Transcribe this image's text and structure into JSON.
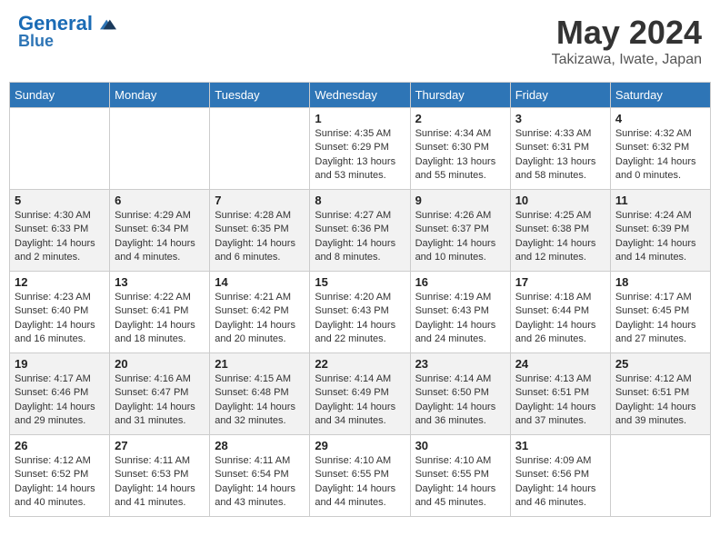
{
  "header": {
    "logo_line1": "General",
    "logo_line2": "Blue",
    "month": "May 2024",
    "location": "Takizawa, Iwate, Japan"
  },
  "weekdays": [
    "Sunday",
    "Monday",
    "Tuesday",
    "Wednesday",
    "Thursday",
    "Friday",
    "Saturday"
  ],
  "weeks": [
    [
      {
        "day": "",
        "info": ""
      },
      {
        "day": "",
        "info": ""
      },
      {
        "day": "",
        "info": ""
      },
      {
        "day": "1",
        "info": "Sunrise: 4:35 AM\nSunset: 6:29 PM\nDaylight: 13 hours\nand 53 minutes."
      },
      {
        "day": "2",
        "info": "Sunrise: 4:34 AM\nSunset: 6:30 PM\nDaylight: 13 hours\nand 55 minutes."
      },
      {
        "day": "3",
        "info": "Sunrise: 4:33 AM\nSunset: 6:31 PM\nDaylight: 13 hours\nand 58 minutes."
      },
      {
        "day": "4",
        "info": "Sunrise: 4:32 AM\nSunset: 6:32 PM\nDaylight: 14 hours\nand 0 minutes."
      }
    ],
    [
      {
        "day": "5",
        "info": "Sunrise: 4:30 AM\nSunset: 6:33 PM\nDaylight: 14 hours\nand 2 minutes."
      },
      {
        "day": "6",
        "info": "Sunrise: 4:29 AM\nSunset: 6:34 PM\nDaylight: 14 hours\nand 4 minutes."
      },
      {
        "day": "7",
        "info": "Sunrise: 4:28 AM\nSunset: 6:35 PM\nDaylight: 14 hours\nand 6 minutes."
      },
      {
        "day": "8",
        "info": "Sunrise: 4:27 AM\nSunset: 6:36 PM\nDaylight: 14 hours\nand 8 minutes."
      },
      {
        "day": "9",
        "info": "Sunrise: 4:26 AM\nSunset: 6:37 PM\nDaylight: 14 hours\nand 10 minutes."
      },
      {
        "day": "10",
        "info": "Sunrise: 4:25 AM\nSunset: 6:38 PM\nDaylight: 14 hours\nand 12 minutes."
      },
      {
        "day": "11",
        "info": "Sunrise: 4:24 AM\nSunset: 6:39 PM\nDaylight: 14 hours\nand 14 minutes."
      }
    ],
    [
      {
        "day": "12",
        "info": "Sunrise: 4:23 AM\nSunset: 6:40 PM\nDaylight: 14 hours\nand 16 minutes."
      },
      {
        "day": "13",
        "info": "Sunrise: 4:22 AM\nSunset: 6:41 PM\nDaylight: 14 hours\nand 18 minutes."
      },
      {
        "day": "14",
        "info": "Sunrise: 4:21 AM\nSunset: 6:42 PM\nDaylight: 14 hours\nand 20 minutes."
      },
      {
        "day": "15",
        "info": "Sunrise: 4:20 AM\nSunset: 6:43 PM\nDaylight: 14 hours\nand 22 minutes."
      },
      {
        "day": "16",
        "info": "Sunrise: 4:19 AM\nSunset: 6:43 PM\nDaylight: 14 hours\nand 24 minutes."
      },
      {
        "day": "17",
        "info": "Sunrise: 4:18 AM\nSunset: 6:44 PM\nDaylight: 14 hours\nand 26 minutes."
      },
      {
        "day": "18",
        "info": "Sunrise: 4:17 AM\nSunset: 6:45 PM\nDaylight: 14 hours\nand 27 minutes."
      }
    ],
    [
      {
        "day": "19",
        "info": "Sunrise: 4:17 AM\nSunset: 6:46 PM\nDaylight: 14 hours\nand 29 minutes."
      },
      {
        "day": "20",
        "info": "Sunrise: 4:16 AM\nSunset: 6:47 PM\nDaylight: 14 hours\nand 31 minutes."
      },
      {
        "day": "21",
        "info": "Sunrise: 4:15 AM\nSunset: 6:48 PM\nDaylight: 14 hours\nand 32 minutes."
      },
      {
        "day": "22",
        "info": "Sunrise: 4:14 AM\nSunset: 6:49 PM\nDaylight: 14 hours\nand 34 minutes."
      },
      {
        "day": "23",
        "info": "Sunrise: 4:14 AM\nSunset: 6:50 PM\nDaylight: 14 hours\nand 36 minutes."
      },
      {
        "day": "24",
        "info": "Sunrise: 4:13 AM\nSunset: 6:51 PM\nDaylight: 14 hours\nand 37 minutes."
      },
      {
        "day": "25",
        "info": "Sunrise: 4:12 AM\nSunset: 6:51 PM\nDaylight: 14 hours\nand 39 minutes."
      }
    ],
    [
      {
        "day": "26",
        "info": "Sunrise: 4:12 AM\nSunset: 6:52 PM\nDaylight: 14 hours\nand 40 minutes."
      },
      {
        "day": "27",
        "info": "Sunrise: 4:11 AM\nSunset: 6:53 PM\nDaylight: 14 hours\nand 41 minutes."
      },
      {
        "day": "28",
        "info": "Sunrise: 4:11 AM\nSunset: 6:54 PM\nDaylight: 14 hours\nand 43 minutes."
      },
      {
        "day": "29",
        "info": "Sunrise: 4:10 AM\nSunset: 6:55 PM\nDaylight: 14 hours\nand 44 minutes."
      },
      {
        "day": "30",
        "info": "Sunrise: 4:10 AM\nSunset: 6:55 PM\nDaylight: 14 hours\nand 45 minutes."
      },
      {
        "day": "31",
        "info": "Sunrise: 4:09 AM\nSunset: 6:56 PM\nDaylight: 14 hours\nand 46 minutes."
      },
      {
        "day": "",
        "info": ""
      }
    ]
  ]
}
